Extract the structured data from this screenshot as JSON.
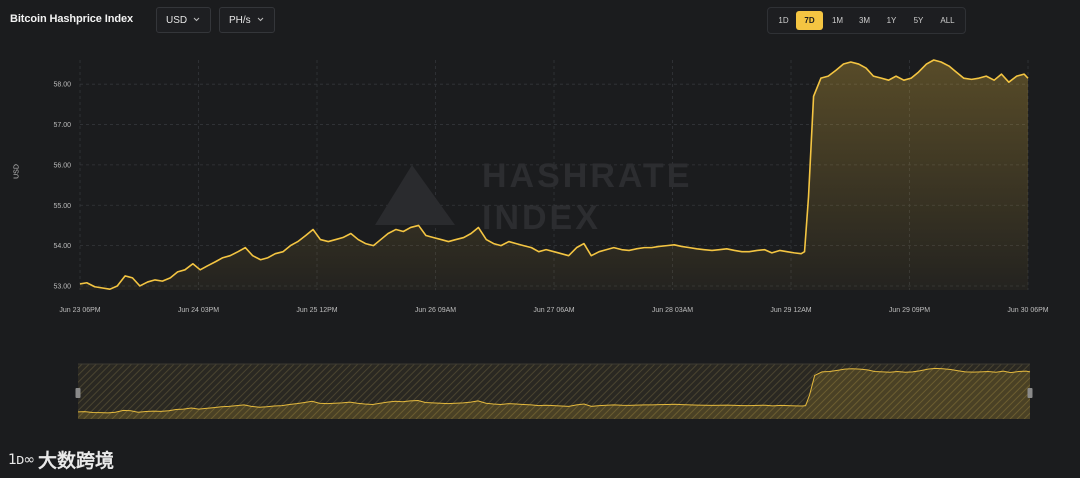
{
  "header": {
    "title": "Bitcoin Hashprice Index",
    "currency_dropdown": "USD",
    "unit_dropdown": "PH/s"
  },
  "range_buttons": [
    {
      "label": "1D",
      "active": false
    },
    {
      "label": "7D",
      "active": true
    },
    {
      "label": "1M",
      "active": false
    },
    {
      "label": "3M",
      "active": false
    },
    {
      "label": "1Y",
      "active": false
    },
    {
      "label": "5Y",
      "active": false
    },
    {
      "label": "ALL",
      "active": false
    }
  ],
  "colors": {
    "accent": "#f4c542",
    "background": "#1b1c1e",
    "grid": "#34363a"
  },
  "watermark": [
    "HASHRATE",
    "INDEX"
  ],
  "footer_logo": {
    "mark": "1ᴅ∞",
    "text": "大数跨境"
  },
  "chart_data": {
    "type": "area",
    "title": "",
    "xlabel": "",
    "ylabel": "USD",
    "x_ticks": [
      "Jun 23 06PM",
      "Jun 24 03PM",
      "Jun 25 12PM",
      "Jun 26 09AM",
      "Jun 27 06AM",
      "Jun 28 03AM",
      "Jun 29 12AM",
      "Jun 29 09PM",
      "Jun 30 06PM"
    ],
    "y_ticks": [
      "53.00",
      "54.00",
      "55.00",
      "56.00",
      "57.00",
      "58.00"
    ],
    "ylim": [
      52.9,
      58.6
    ],
    "x_range_hours": [
      0,
      168
    ],
    "grid": true,
    "navigator": true,
    "series": [
      {
        "x_hours": [
          0,
          1.2,
          2.6,
          4,
          5.3,
          6.6,
          8,
          9.3,
          10.6,
          12,
          13.3,
          14.6,
          16,
          17.3,
          18.6,
          20,
          21.3,
          22.6,
          24,
          25.3,
          26.6,
          28,
          29.3,
          30.6,
          32,
          33.3,
          34.6,
          36,
          37.3,
          38.6,
          40,
          41.3,
          42.6,
          44,
          45.3,
          46.6,
          48,
          49.3,
          50.6,
          52,
          53.3,
          54.6,
          56,
          57.3,
          58.6,
          60,
          61.3,
          62.6,
          64,
          65.3,
          66.6,
          68,
          69.3,
          70.6,
          72,
          73.3,
          74.6,
          76,
          77.3,
          78.6,
          80,
          81.3,
          82.6,
          84,
          85.3,
          86.6,
          88,
          89.3,
          90.6,
          92,
          93.3,
          94.6,
          96,
          97.3,
          98.6,
          100,
          101.3,
          102.6,
          104,
          105.3,
          106.6,
          108,
          109.3,
          110.6,
          112,
          113.3,
          114.6,
          116,
          117.3,
          118.6,
          120,
          121.3,
          122.6,
          124,
          125.3,
          126.6,
          127.8,
          128.4,
          129.1,
          130,
          131.3,
          132.6,
          134,
          135.3,
          136.6,
          138,
          139.3,
          140.6,
          142,
          143.3,
          144.6,
          146,
          147.3,
          148.6,
          150,
          151.3,
          152.6,
          154,
          155.3,
          156.6,
          158,
          159.3,
          160.6,
          162,
          163.3,
          164.6,
          166,
          167.3,
          168
        ],
        "values": [
          53.05,
          53.08,
          52.98,
          52.95,
          52.92,
          53.0,
          53.25,
          53.2,
          53.0,
          53.1,
          53.15,
          53.12,
          53.2,
          53.35,
          53.4,
          53.55,
          53.4,
          53.5,
          53.6,
          53.7,
          53.75,
          53.85,
          53.95,
          53.75,
          53.65,
          53.7,
          53.8,
          53.85,
          54.0,
          54.1,
          54.25,
          54.4,
          54.15,
          54.1,
          54.15,
          54.2,
          54.3,
          54.15,
          54.05,
          54.0,
          54.15,
          54.3,
          54.4,
          54.35,
          54.45,
          54.5,
          54.25,
          54.2,
          54.15,
          54.1,
          54.15,
          54.2,
          54.3,
          54.45,
          54.15,
          54.05,
          54.0,
          54.1,
          54.05,
          54.0,
          53.95,
          53.85,
          53.9,
          53.85,
          53.8,
          53.75,
          53.95,
          54.05,
          53.75,
          53.85,
          53.9,
          53.95,
          53.9,
          53.88,
          53.92,
          53.95,
          53.95,
          53.98,
          54.0,
          54.02,
          53.98,
          53.95,
          53.92,
          53.9,
          53.88,
          53.9,
          53.92,
          53.88,
          53.85,
          53.85,
          53.88,
          53.9,
          53.82,
          53.88,
          53.85,
          53.82,
          53.8,
          53.85,
          55.2,
          57.7,
          58.15,
          58.2,
          58.35,
          58.5,
          58.55,
          58.5,
          58.4,
          58.2,
          58.15,
          58.1,
          58.2,
          58.1,
          58.15,
          58.3,
          58.5,
          58.6,
          58.55,
          58.45,
          58.3,
          58.15,
          58.12,
          58.15,
          58.2,
          58.1,
          58.25,
          58.05,
          58.2,
          58.25,
          58.15,
          58.3,
          58.15,
          58.2
        ]
      }
    ]
  }
}
